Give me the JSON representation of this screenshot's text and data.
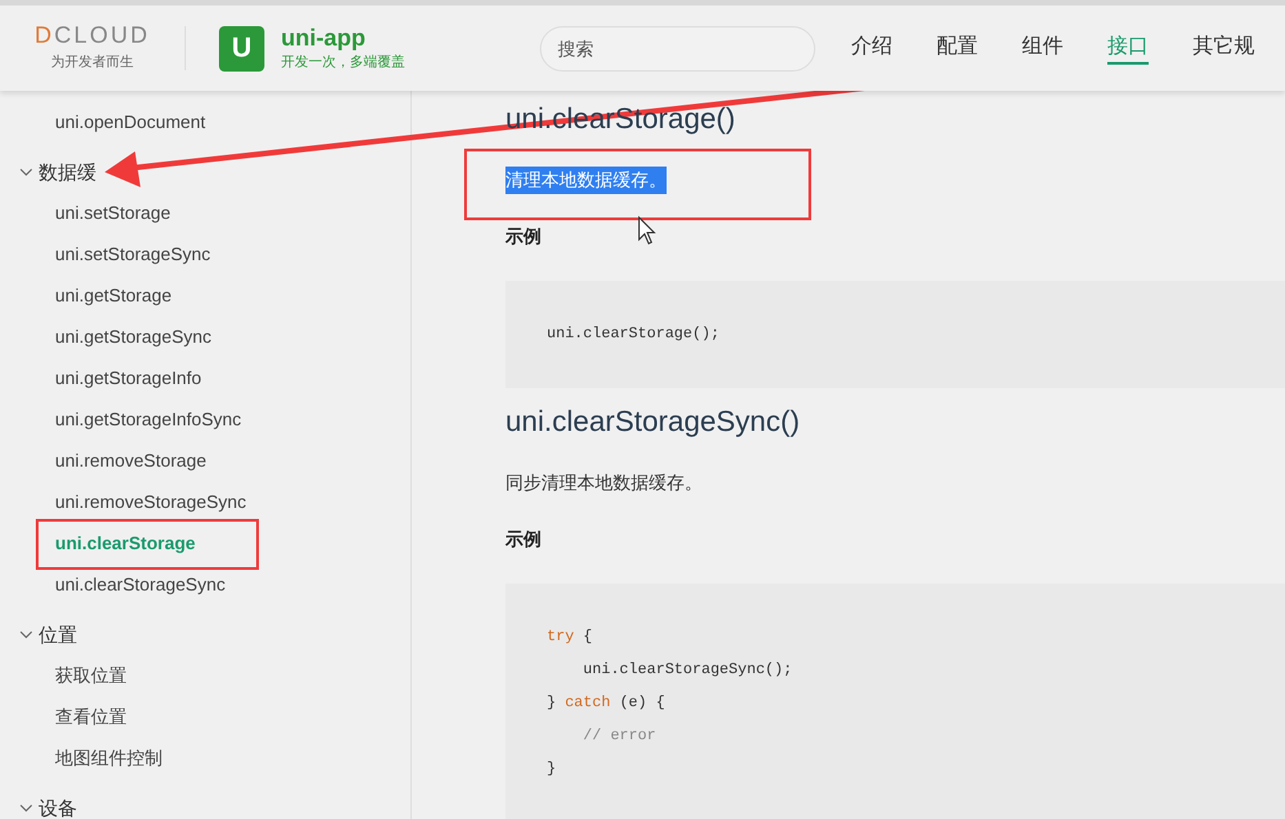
{
  "header": {
    "logo": {
      "wordmark": "DCLOUD",
      "slogan": "为开发者而生"
    },
    "brand": {
      "icon_letter": "U",
      "name": "uni-app",
      "tagline": "开发一次，多端覆盖"
    },
    "search": {
      "placeholder": "搜索"
    },
    "nav": [
      {
        "label": "介绍",
        "selected": false
      },
      {
        "label": "配置",
        "selected": false
      },
      {
        "label": "组件",
        "selected": false
      },
      {
        "label": "接口",
        "selected": true
      },
      {
        "label": "其它规",
        "selected": false
      }
    ]
  },
  "sidebar": {
    "items": [
      {
        "kind": "link",
        "label": "uni.openDocument",
        "selected": false
      },
      {
        "kind": "group",
        "label": "数据缓",
        "expanded": true,
        "children": [
          {
            "label": "uni.setStorage",
            "selected": false
          },
          {
            "label": "uni.setStorageSync",
            "selected": false
          },
          {
            "label": "uni.getStorage",
            "selected": false
          },
          {
            "label": "uni.getStorageSync",
            "selected": false
          },
          {
            "label": "uni.getStorageInfo",
            "selected": false
          },
          {
            "label": "uni.getStorageInfoSync",
            "selected": false
          },
          {
            "label": "uni.removeStorage",
            "selected": false
          },
          {
            "label": "uni.removeStorageSync",
            "selected": false
          },
          {
            "label": "uni.clearStorage",
            "selected": true
          },
          {
            "label": "uni.clearStorageSync",
            "selected": false
          }
        ]
      },
      {
        "kind": "group",
        "label": "位置",
        "expanded": true,
        "children": [
          {
            "label": "获取位置",
            "selected": false
          },
          {
            "label": "查看位置",
            "selected": false
          },
          {
            "label": "地图组件控制",
            "selected": false
          }
        ]
      },
      {
        "kind": "group",
        "label": "设备",
        "expanded": true
      }
    ]
  },
  "content": {
    "sections": [
      {
        "title": "uni.clearStorage()",
        "description": "清理本地数据缓存。",
        "description_selected": true,
        "example_label": "示例",
        "code": [
          [
            {
              "text": "uni.clearStorage();",
              "kind": "plain"
            }
          ]
        ]
      },
      {
        "title": "uni.clearStorageSync()",
        "description": "同步清理本地数据缓存。",
        "description_selected": false,
        "example_label": "示例",
        "code": [
          [
            {
              "text": "try",
              "kind": "keyword"
            },
            {
              "text": " {",
              "kind": "plain"
            }
          ],
          [
            {
              "text": "    uni.clearStorageSync();",
              "kind": "plain"
            }
          ],
          [
            {
              "text": "} ",
              "kind": "plain"
            },
            {
              "text": "catch",
              "kind": "keyword"
            },
            {
              "text": " (e) {",
              "kind": "plain"
            }
          ],
          [
            {
              "text": "    // error",
              "kind": "comment"
            }
          ],
          [
            {
              "text": "}",
              "kind": "plain"
            }
          ]
        ]
      }
    ]
  }
}
